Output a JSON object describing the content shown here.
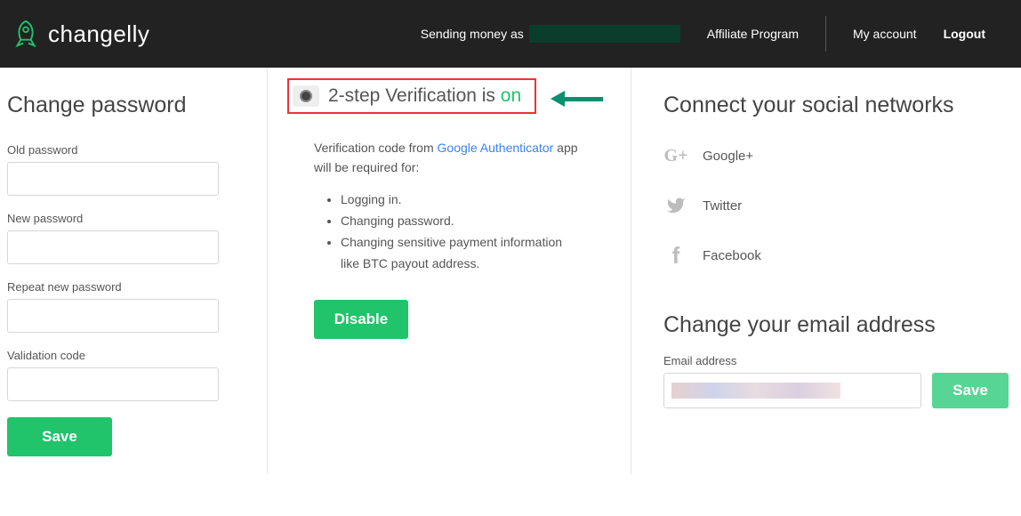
{
  "header": {
    "brand": "changelly",
    "sending_label": "Sending money as",
    "nav": {
      "affiliate": "Affiliate Program",
      "account": "My account",
      "logout": "Logout"
    }
  },
  "password_panel": {
    "title": "Change password",
    "old_label": "Old password",
    "new_label": "New password",
    "repeat_label": "Repeat new password",
    "validation_label": "Validation code",
    "save_label": "Save"
  },
  "twostep": {
    "title_prefix": "2-step Verification is ",
    "status": "on",
    "desc_prefix": "Verification code from ",
    "desc_link": "Google Authenticator",
    "desc_suffix": " app will be required for:",
    "req1": "Logging in.",
    "req2": "Changing password.",
    "req3": "Changing sensitive payment information like BTC payout address.",
    "disable_label": "Disable"
  },
  "social": {
    "title": "Connect your social networks",
    "google": "Google+",
    "twitter": "Twitter",
    "facebook": "Facebook"
  },
  "email_panel": {
    "title": "Change your email address",
    "label": "Email address",
    "save_label": "Save"
  }
}
